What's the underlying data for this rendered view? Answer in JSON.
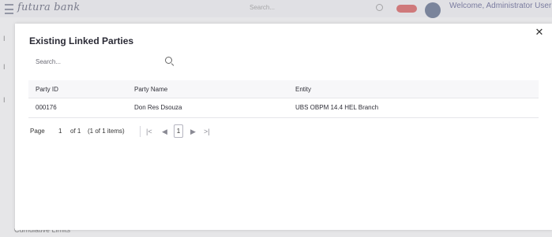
{
  "app": {
    "logo_text": "futura bank",
    "search_placeholder": "Search...",
    "welcome_text": "Welcome, Administrator User",
    "footer_partial": "Cumulative Limits"
  },
  "modal": {
    "title": "Existing Linked Parties",
    "close_icon": "close-icon",
    "search": {
      "placeholder": "Search...",
      "value": ""
    }
  },
  "table": {
    "headers": [
      "Party ID",
      "Party Name",
      "Entity"
    ],
    "rows": [
      [
        "000176",
        "Don Res Dsouza",
        "UBS OBPM 14.4 HEL Branch"
      ]
    ]
  },
  "pagination": {
    "page_label": "Page",
    "page_number": "1",
    "of_label": "of 1",
    "items_label": "(1 of 1 items)",
    "current": "1",
    "first_icon": "first-page-icon",
    "prev_icon": "prev-page-icon",
    "next_icon": "next-page-icon",
    "last_icon": "last-page-icon"
  },
  "colors": {
    "accent": "#3b4d74",
    "badge": "#d63a3a"
  }
}
